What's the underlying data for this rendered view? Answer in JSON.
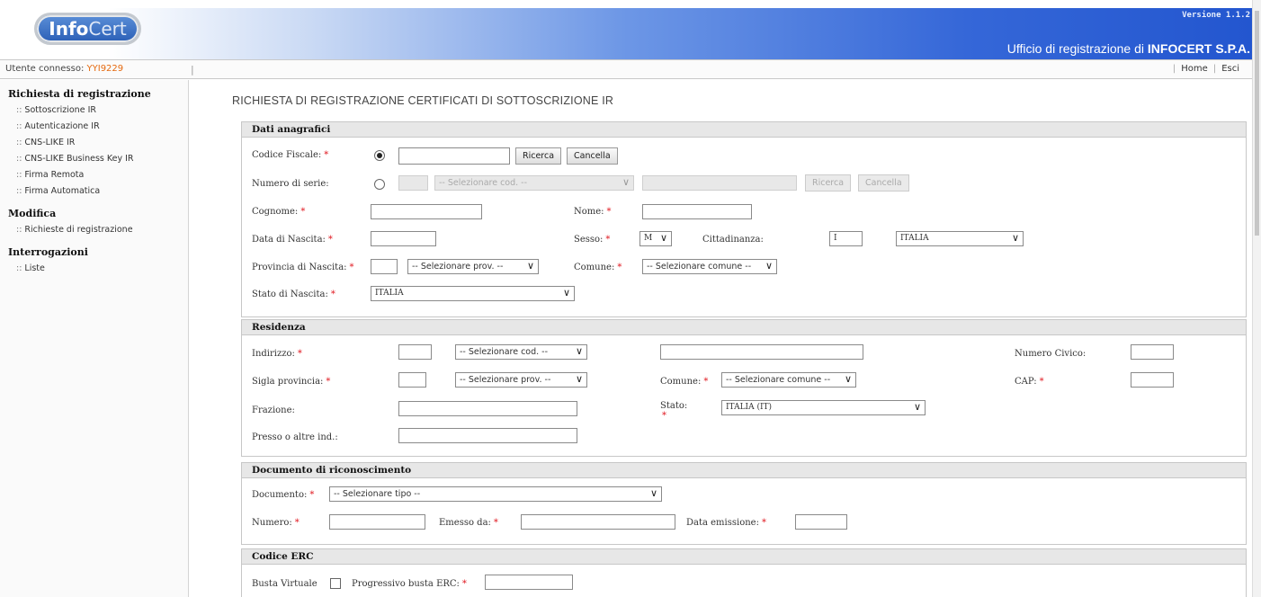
{
  "header": {
    "logo_text_1": "Info",
    "logo_text_2": "Cert",
    "version": "Versione 1.1.2",
    "office_prefix": "Ufficio di registrazione di",
    "office_name": "INFOCERT S.P.A."
  },
  "userbar": {
    "user_label": "Utente connesso:",
    "user_id": "YYI9229",
    "separator": "|",
    "home": "Home",
    "exit": "Esci"
  },
  "sidebar": {
    "groups": [
      {
        "title": "Richiesta di registrazione",
        "items": [
          "Sottoscrizione IR",
          "Autenticazione IR",
          "CNS-LIKE IR",
          "CNS-LIKE Business Key IR",
          "Firma Remota",
          "Firma Automatica"
        ]
      },
      {
        "title": "Modifica",
        "items": [
          "Richieste di registrazione"
        ]
      },
      {
        "title": "Interrogazioni",
        "items": [
          "Liste"
        ]
      }
    ]
  },
  "page_title": "RICHIESTA DI REGISTRAZIONE CERTIFICATI DI SOTTOSCRIZIONE IR",
  "required_mark": "*",
  "anagrafici": {
    "title": "Dati anagrafici",
    "codice_fiscale": "Codice Fiscale:",
    "numero_serie": "Numero di serie:",
    "serie_select": "-- Selezionare cod. --",
    "ricerca": "Ricerca",
    "cancella": "Cancella",
    "cognome": "Cognome:",
    "nome": "Nome:",
    "data_nascita": "Data di Nascita:",
    "sesso": "Sesso:",
    "sesso_value": "M",
    "cittadinanza": "Cittadinanza:",
    "cittadinanza_code": "I",
    "cittadinanza_value": "ITALIA",
    "provincia_nascita": "Provincia di Nascita:",
    "prov_select": "-- Selezionare prov. --",
    "comune": "Comune:",
    "comune_select": "-- Selezionare comune --",
    "stato_nascita": "Stato di Nascita:",
    "stato_value": "ITALIA"
  },
  "residenza": {
    "title": "Residenza",
    "indirizzo": "Indirizzo:",
    "cod_select": "-- Selezionare cod. --",
    "numero_civico": "Numero Civico:",
    "sigla_provincia": "Sigla provincia:",
    "prov_select": "-- Selezionare prov. --",
    "comune": "Comune:",
    "comune_select": "-- Selezionare comune --",
    "cap": "CAP:",
    "frazione": "Frazione:",
    "stato": "Stato:",
    "stato_value": "ITALIA (IT)",
    "presso": "Presso o altre ind.:"
  },
  "documento": {
    "title": "Documento di riconoscimento",
    "documento": "Documento:",
    "tipo_select": "-- Selezionare tipo --",
    "numero": "Numero:",
    "emesso_da": "Emesso da:",
    "data_emissione": "Data emissione:"
  },
  "erc": {
    "title": "Codice ERC",
    "busta_virtuale": "Busta Virtuale",
    "progressivo": "Progressivo busta ERC:"
  }
}
